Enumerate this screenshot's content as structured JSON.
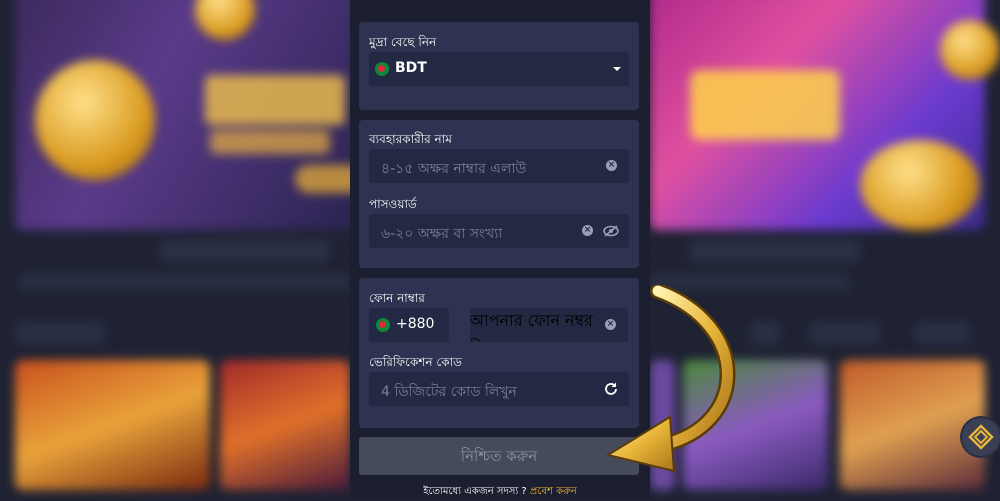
{
  "currency": {
    "label": "মুদ্রা বেছে নিন",
    "value": "BDT"
  },
  "username": {
    "label": "ব্যবহারকারীর নাম",
    "placeholder": "৪-১৫ অক্ষর নাম্বার এলাউ"
  },
  "password": {
    "label": "পাসওয়ার্ড",
    "placeholder": "৬-২০ অক্ষর বা সংখ্যা"
  },
  "phone": {
    "label": "ফোন নাম্বার",
    "country_code": "+880",
    "placeholder": "আপনার ফোন নম্বর লিখুন"
  },
  "verification": {
    "label": "ভেরিফিকেশন কোড",
    "placeholder": "4 ডিজিটের কোড লিখুন"
  },
  "confirm_button": "নিশ্চিত করুন",
  "footer": {
    "member_text": "ইতোমধ্যে একজন সদস্য ?",
    "login_link": "প্রবেশ করুন"
  },
  "colors": {
    "accent": "#f1b82d",
    "panel": "#1b1f2f",
    "section": "#2d3350",
    "field": "#232943"
  },
  "icons": [
    "bangladesh-flag-icon",
    "dropdown-caret-icon",
    "clear-icon",
    "hide-password-icon",
    "refresh-icon",
    "curved-arrow-icon"
  ]
}
